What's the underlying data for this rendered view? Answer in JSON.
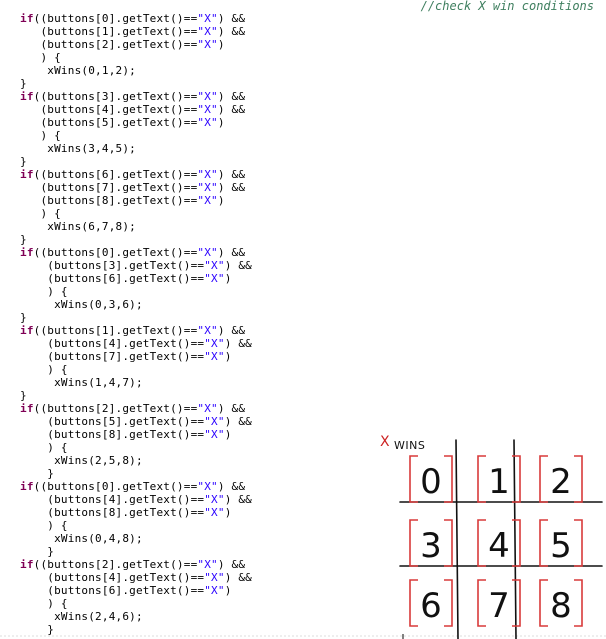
{
  "comment": "//check X win conditions",
  "code_lines": [
    "if((buttons[0].getText()==\"X\") &&",
    "   (buttons[1].getText()==\"X\") &&",
    "   (buttons[2].getText()==\"X\")",
    "   ) {",
    "    xWins(0,1,2);",
    "}",
    "if((buttons[3].getText()==\"X\") &&",
    "   (buttons[4].getText()==\"X\") &&",
    "   (buttons[5].getText()==\"X\")",
    "   ) {",
    "    xWins(3,4,5);",
    "}",
    "if((buttons[6].getText()==\"X\") &&",
    "   (buttons[7].getText()==\"X\") &&",
    "   (buttons[8].getText()==\"X\")",
    "   ) {",
    "    xWins(6,7,8);",
    "}",
    "if((buttons[0].getText()==\"X\") &&",
    "    (buttons[3].getText()==\"X\") &&",
    "    (buttons[6].getText()==\"X\")",
    "    ) {",
    "     xWins(0,3,6);",
    "}",
    "if((buttons[1].getText()==\"X\") &&",
    "    (buttons[4].getText()==\"X\") &&",
    "    (buttons[7].getText()==\"X\")",
    "    ) {",
    "     xWins(1,4,7);",
    "}",
    "if((buttons[2].getText()==\"X\") &&",
    "    (buttons[5].getText()==\"X\") &&",
    "    (buttons[8].getText()==\"X\")",
    "    ) {",
    "     xWins(2,5,8);",
    "    }",
    "if((buttons[0].getText()==\"X\") &&",
    "    (buttons[4].getText()==\"X\") &&",
    "    (buttons[8].getText()==\"X\")",
    "    ) {",
    "     xWins(0,4,8);",
    "    }",
    "if((buttons[2].getText()==\"X\") &&",
    "    (buttons[4].getText()==\"X\") &&",
    "    (buttons[6].getText()==\"X\")",
    "    ) {",
    "     xWins(2,4,6);",
    "    }"
  ],
  "sketch": {
    "x_mark": "X",
    "label": "WINS",
    "cells": [
      "0",
      "1",
      "2",
      "3",
      "4",
      "5",
      "6",
      "7",
      "8"
    ],
    "bracket_color": "#d83a3a",
    "grid_color": "#111111"
  },
  "colors": {
    "keyword": "#7f0055",
    "string": "#2a00ff",
    "comment": "#3f7f5f"
  }
}
